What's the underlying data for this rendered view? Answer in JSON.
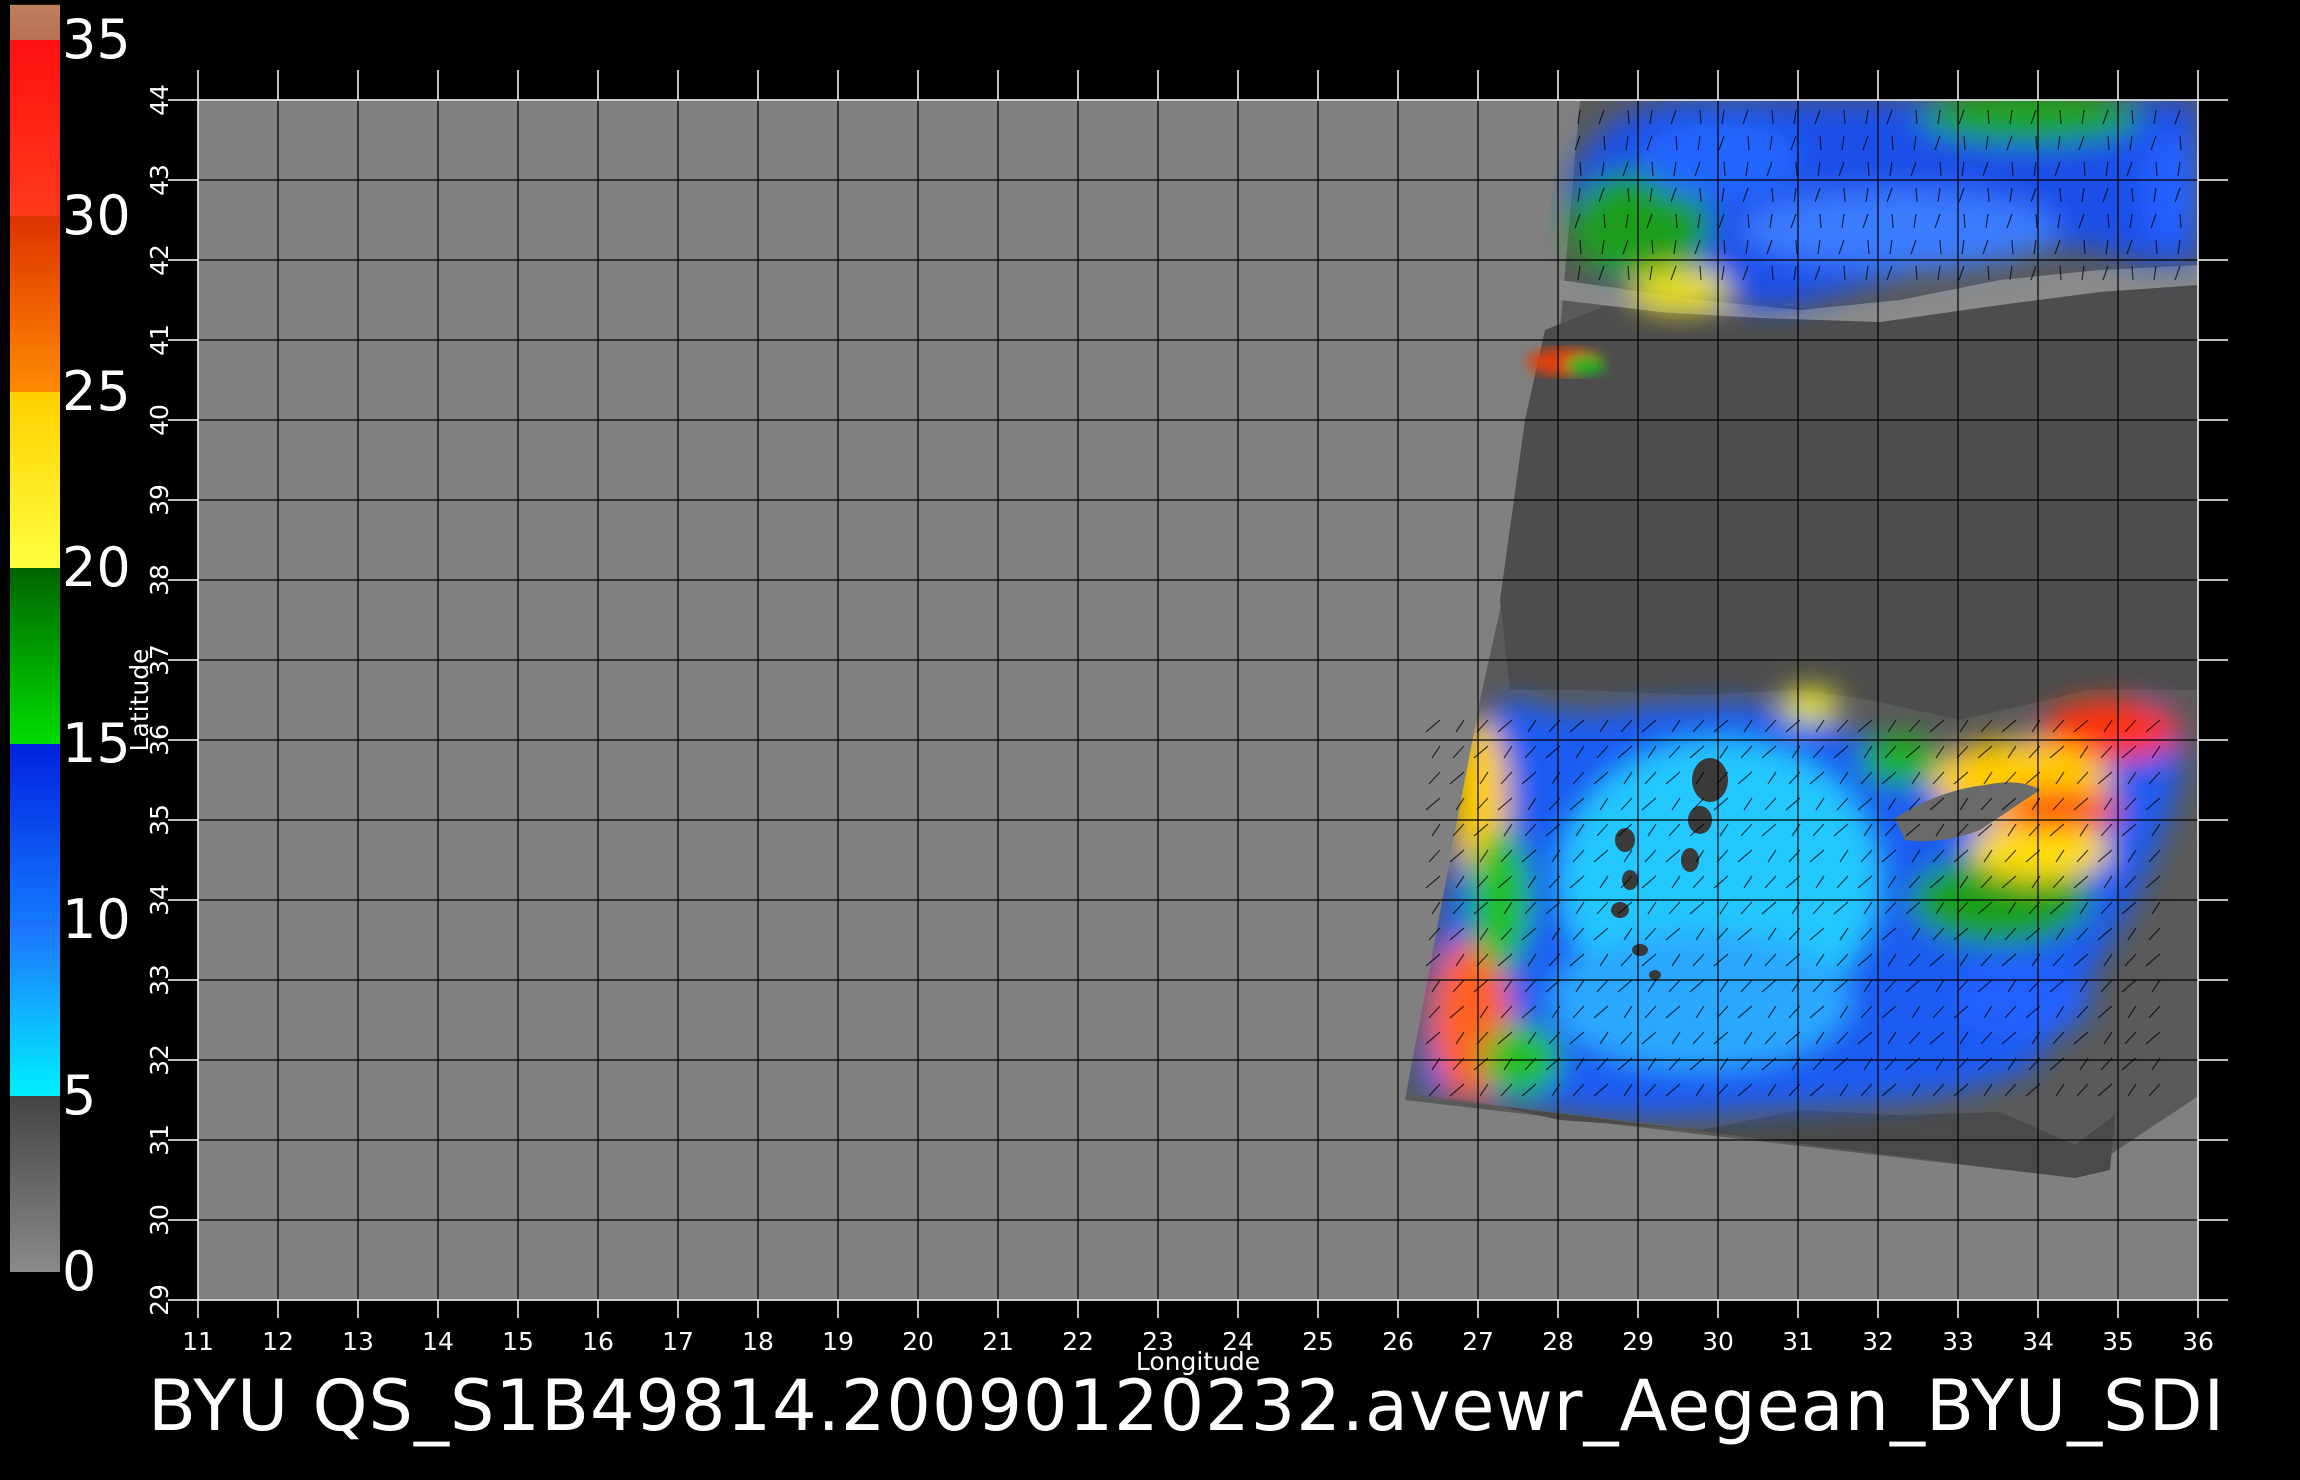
{
  "footer_text": "BYU QS_S1B49814.20090120232.avewr_Aegean_BYU_SDI",
  "colorbar": {
    "labels": [
      "0",
      "5",
      "10",
      "15",
      "20",
      "25",
      "30",
      "35"
    ],
    "values": [
      0,
      5,
      10,
      15,
      20,
      25,
      30,
      35
    ],
    "segments": [
      {
        "from": 0,
        "to": 5,
        "top": "#444444",
        "bottom": "#8a8a8a"
      },
      {
        "from": 5,
        "to": 10,
        "top": "#1f6fff",
        "bottom": "#00f0ff"
      },
      {
        "from": 10,
        "to": 15,
        "top": "#0022dd",
        "bottom": "#1477ff"
      },
      {
        "from": 15,
        "to": 20,
        "top": "#006400",
        "bottom": "#00dd00"
      },
      {
        "from": 20,
        "to": 25,
        "top": "#ffd000",
        "bottom": "#ffff40"
      },
      {
        "from": 25,
        "to": 30,
        "top": "#dd3300",
        "bottom": "#ff8a00"
      },
      {
        "from": 30,
        "to": 35,
        "top": "#ff1010",
        "bottom": "#ff3a1a"
      },
      {
        "from": 35,
        "to": 36,
        "top": "#c08060",
        "bottom": "#b87050"
      }
    ]
  },
  "map": {
    "xlabel": "Longitude",
    "ylabel": "Latitude",
    "lon_ticks": [
      11,
      12,
      13,
      14,
      15,
      16,
      17,
      18,
      19,
      20,
      21,
      22,
      23,
      24,
      25,
      26,
      27,
      28,
      29,
      30,
      31,
      32,
      33,
      34,
      35,
      36
    ],
    "lat_ticks": [
      29,
      30,
      31,
      32,
      33,
      34,
      35,
      36,
      37,
      38,
      39,
      40,
      41,
      42,
      43,
      44
    ],
    "lon_range": [
      11,
      36
    ],
    "lat_range": [
      29,
      44
    ],
    "background_color": "#808080",
    "grid_color": "#000000",
    "swath_color": "#585858",
    "land_color": "#4c4c4c"
  }
}
